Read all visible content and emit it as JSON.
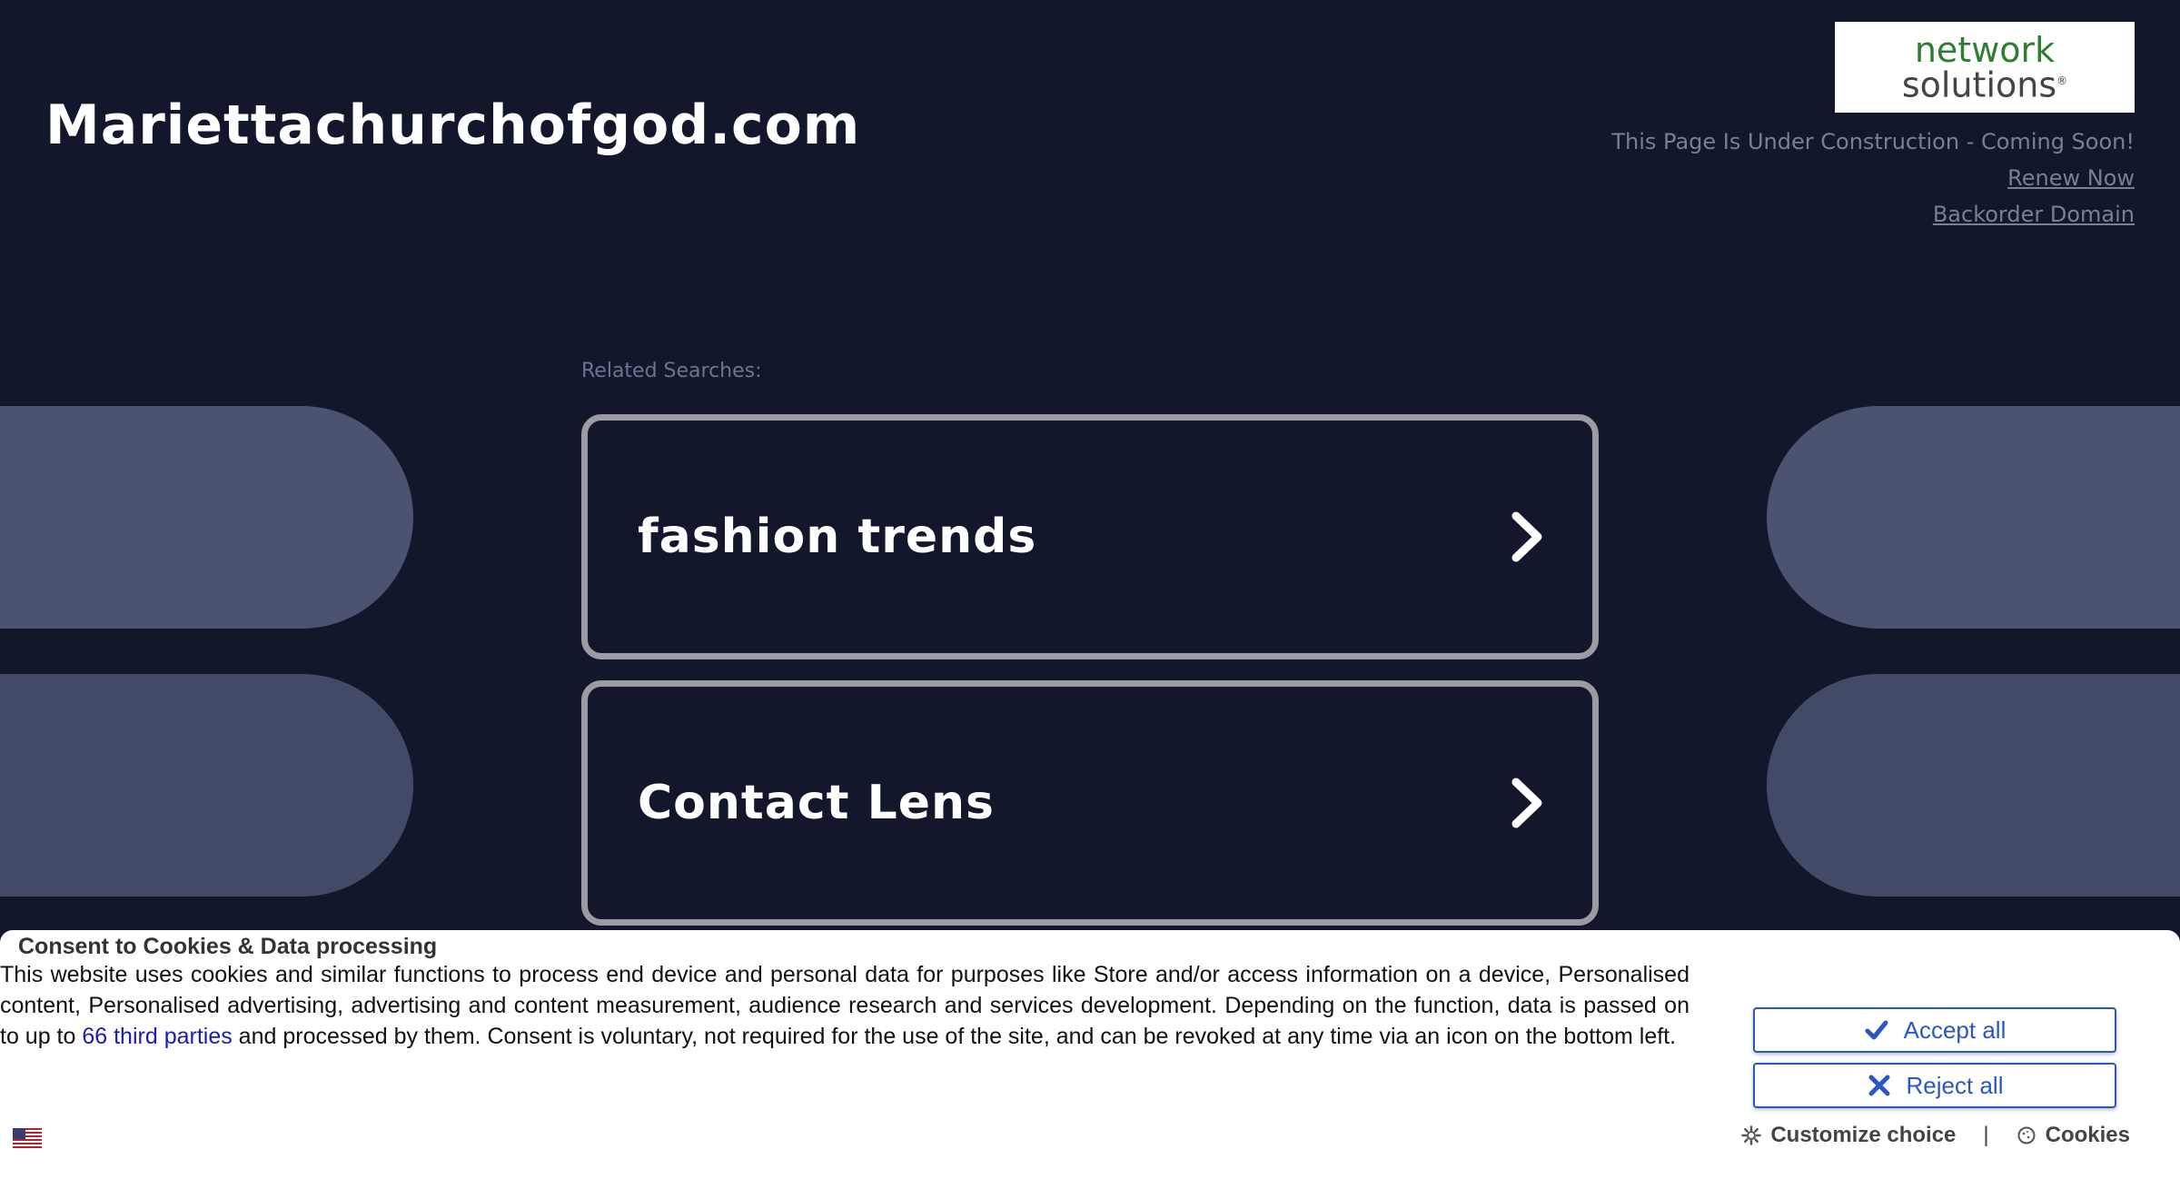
{
  "header": {
    "site_title": "Mariettachurchofgod.com",
    "logo_line1": "network",
    "logo_line2": "solutions",
    "logo_mark": "®",
    "status_text": "This Page Is Under Construction - Coming Soon!",
    "renew_link": "Renew Now",
    "backorder_link": "Backorder Domain"
  },
  "related": {
    "label": "Related Searches:",
    "items": [
      {
        "label": "fashion trends",
        "icon": "chevron-right-icon"
      },
      {
        "label": "Contact Lens",
        "icon": "chevron-right-icon"
      }
    ]
  },
  "consent": {
    "title": "Consent to Cookies & Data processing",
    "body_before": "This website uses cookies and similar functions to process end device and personal data for purposes like Store and/or access information on a device, Personalised content, Personalised advertising, advertising and content measurement, audience research and services development. Depending on the function, data is passed on to up to ",
    "third_parties_link": "66 third parties",
    "body_after": " and processed by them. Consent is voluntary, not required for the use of the site, and can be revoked at any time via an icon on the bottom left.",
    "accept_label": "Accept all",
    "reject_label": "Reject all",
    "customize_label": "Customize choice",
    "separator": "|",
    "cookies_label": "Cookies",
    "language_icon": "us-flag-icon"
  },
  "colors": {
    "background": "#13172c",
    "card_border": "#9a9ba3",
    "button_blue": "#2a56c6",
    "logo_green": "#2e7d32"
  }
}
